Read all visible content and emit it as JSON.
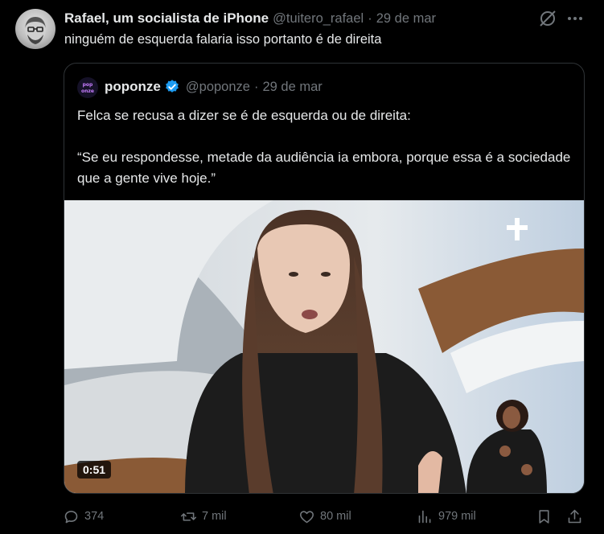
{
  "tweet": {
    "author_name": "Rafael, um socialista de iPhone",
    "handle": "@tuitero_rafael",
    "separator": "·",
    "date": "29 de mar",
    "text": "ninguém de esquerda falaria isso portanto é de direita"
  },
  "quote": {
    "author_name": "poponze",
    "handle": "@poponze",
    "separator": "·",
    "date": "29 de mar",
    "avatar_label": "ponze",
    "text_line1": "Felca se recusa a dizer se é de esquerda ou de direita:",
    "text_line2": "“Se eu respondesse, metade da audiência ia embora, porque essa é a sociedade que a gente vive hoje.”",
    "video_duration": "0:51"
  },
  "actions": {
    "replies": "374",
    "reposts": "7 mil",
    "likes": "80 mil",
    "views": "979 mil"
  },
  "icons": {
    "grok": "grok-icon",
    "more": "more-icon",
    "verified": "verified-badge-icon",
    "reply": "reply-icon",
    "repost": "repost-icon",
    "like": "heart-icon",
    "views": "views-icon",
    "bookmark": "bookmark-icon",
    "share": "share-icon"
  },
  "colors": {
    "background": "#000000",
    "text": "#e7e9ea",
    "muted": "#71767b",
    "border": "#2f3336",
    "verified": "#1d9bf0"
  }
}
